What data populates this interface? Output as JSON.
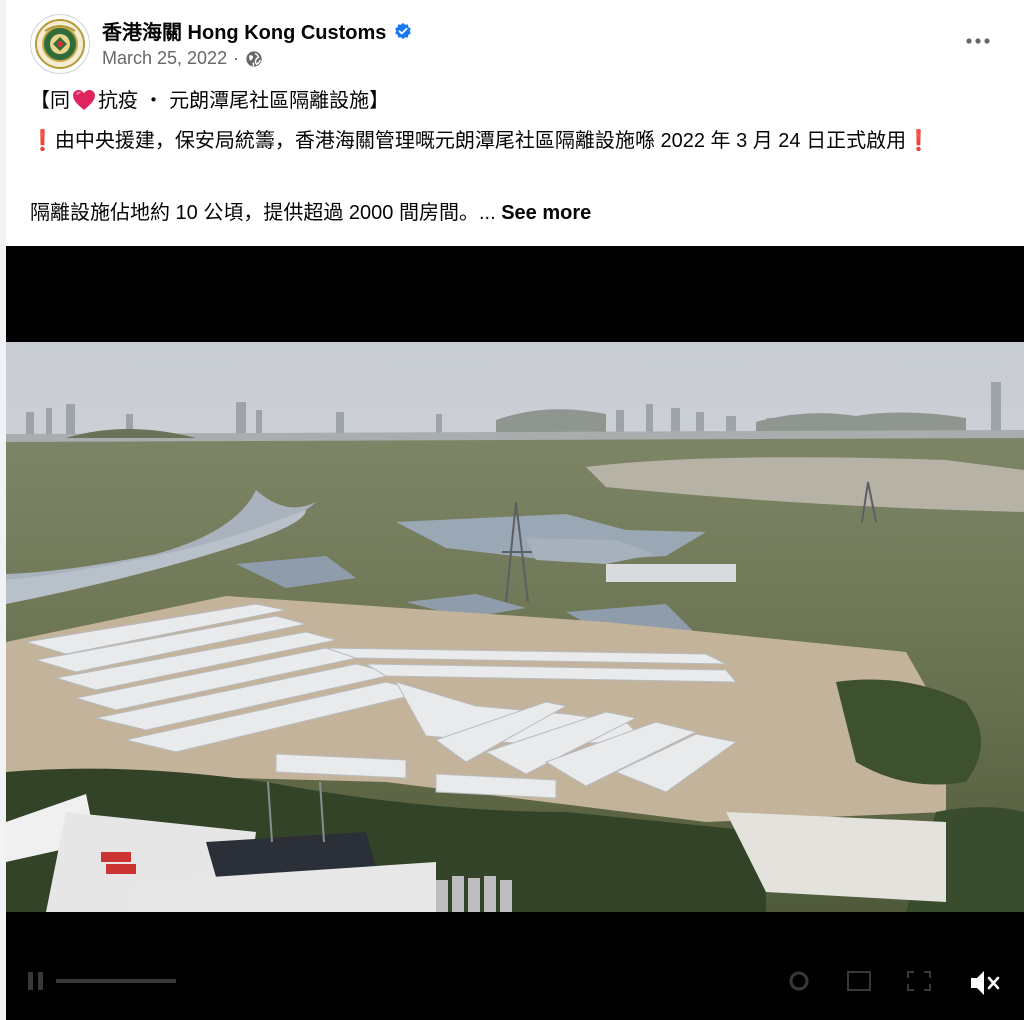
{
  "post": {
    "page_name": "香港海關 Hong Kong Customs",
    "date": "March 25, 2022",
    "date_separator": "·",
    "audience_icon": "globe-icon",
    "verified_icon": "verified-badge-icon",
    "more_icon": "more-options-icon"
  },
  "caption": {
    "line1_open": "【同",
    "line1_heart_icon": "red-heart-icon",
    "line1_rest": "抗疫 ・ 元朗潭尾社區隔離設施】",
    "line2_mark_icon": "exclamation-icon",
    "line2_mark_start": "❗",
    "line2_text": "由中央援建，保安局統籌，香港海關管理嘅元朗潭尾社區隔離設施喺 2022 年 3 月 24 日正式啟用",
    "line2_mark_end": "❗",
    "line3_text": "隔離設施佔地約 10 公頃，提供超過 2000 間房間。...",
    "see_more": "See more"
  },
  "video": {
    "volume_icon": "speaker-muted-icon",
    "play_icon": "pause-icon"
  },
  "colors": {
    "text": "#050505",
    "secondary": "#65676b",
    "verified": "#1877f2",
    "heart": "#e0245e"
  }
}
